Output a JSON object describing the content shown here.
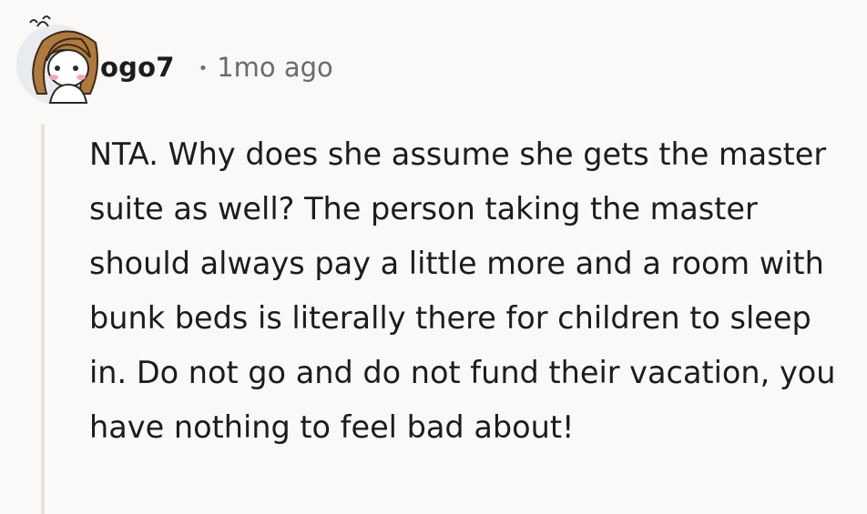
{
  "comment": {
    "avatar_icon": "user-avatar-icon",
    "username": "ogo7",
    "separator": "•",
    "timestamp": "1mo ago",
    "body": "NTA. Why does she assume she gets the master suite as well? The person taking the master should always pay a little more and a room with bunk beds is literally there for children to sleep in. Do not go and do not fund their vacation, you have nothing to feel bad about!"
  },
  "colors": {
    "background": "#faf9f7",
    "text": "#1c1c1c",
    "muted_text": "#6b6b6b",
    "thread_line": "#e9e1db"
  }
}
